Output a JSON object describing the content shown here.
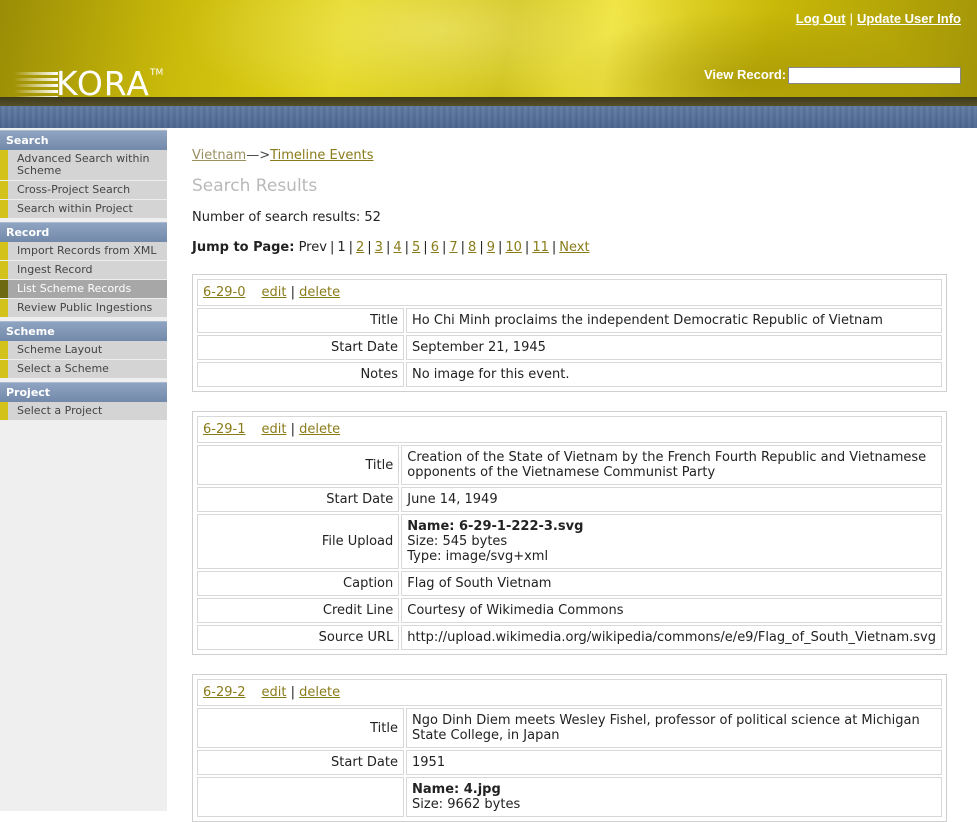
{
  "header": {
    "logo_text": "KORA",
    "logo_tm": "TM",
    "logout": "Log Out",
    "update_user": "Update User Info",
    "separator": "|",
    "view_record_label": "View Record:",
    "view_record_value": ""
  },
  "sidebar": {
    "sections": [
      {
        "title": "Search",
        "items": [
          "Advanced Search within Scheme",
          "Cross-Project Search",
          "Search within Project"
        ]
      },
      {
        "title": "Record",
        "items": [
          "Import Records from XML",
          "Ingest Record",
          "List Scheme Records",
          "Review Public Ingestions"
        ]
      },
      {
        "title": "Scheme",
        "items": [
          "Scheme Layout",
          "Select a Scheme"
        ]
      },
      {
        "title": "Project",
        "items": [
          "Select a Project"
        ]
      }
    ],
    "active_item": "List Scheme Records"
  },
  "breadcrumb": {
    "first": "Vietnam",
    "arrow": "—>",
    "second": "Timeline Events"
  },
  "page_title": "Search Results",
  "result_count": "Number of search results: 52",
  "pager": {
    "label": "Jump to Page:",
    "prev": "Prev",
    "current": "1",
    "pages": [
      "2",
      "3",
      "4",
      "5",
      "6",
      "7",
      "8",
      "9",
      "10",
      "11"
    ],
    "next": "Next"
  },
  "record_actions": {
    "edit": "edit",
    "delete": "delete",
    "sep": "|"
  },
  "records": [
    {
      "id": "6-29-0",
      "fields": [
        {
          "label": "Title",
          "value": "Ho Chi Minh proclaims the independent Democratic Republic of Vietnam"
        },
        {
          "label": "Start Date",
          "value": "September 21, 1945"
        },
        {
          "label": "Notes",
          "value": "No image for this event."
        }
      ]
    },
    {
      "id": "6-29-1",
      "fields": [
        {
          "label": "Title",
          "value": "Creation of the State of Vietnam by the French Fourth Republic and Vietnamese opponents of the Vietnamese Communist Party"
        },
        {
          "label": "Start Date",
          "value": "June 14, 1949"
        },
        {
          "label": "File Upload",
          "file": {
            "name": "Name: 6-29-1-222-3.svg",
            "size": "Size: 545 bytes",
            "type": "Type: image/svg+xml"
          }
        },
        {
          "label": "Caption",
          "value": "Flag of South Vietnam"
        },
        {
          "label": "Credit Line",
          "value": "Courtesy of Wikimedia Commons"
        },
        {
          "label": "Source URL",
          "value": "http://upload.wikimedia.org/wikipedia/commons/e/e9/Flag_of_South_Vietnam.svg"
        }
      ]
    },
    {
      "id": "6-29-2",
      "fields": [
        {
          "label": "Title",
          "value": "Ngo Dinh Diem meets Wesley Fishel, professor of political science at Michigan State College, in Japan"
        },
        {
          "label": "Start Date",
          "value": "1951"
        },
        {
          "label": "",
          "file": {
            "name": "Name: 4.jpg",
            "size": "Size: 9662 bytes",
            "type": ""
          }
        }
      ]
    }
  ]
}
